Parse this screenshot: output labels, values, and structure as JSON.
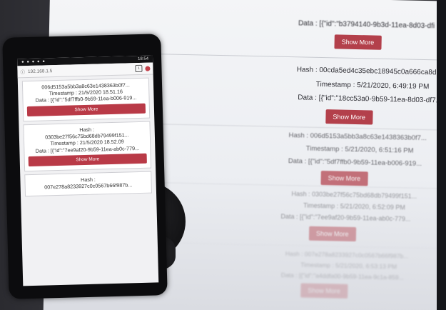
{
  "colors": {
    "button": "#b93a47",
    "monitor_bg": "#eef0f3",
    "phone_body": "#0c0c0e"
  },
  "monitor": {
    "top_data": "Data : [{\"id\":\"b3794140-9b3d-11ea-8d03-dfi",
    "show_more": "Show More",
    "cards": [
      {
        "hash": "Hash : 00cda5ed4c35ebc18945c0a666ca8d...",
        "timestamp": "Timestamp : 5/21/2020, 6:49:19 PM",
        "data": "Data : [{\"id\":\"18cc53a0-9b59-11ea-8d03-df7..."
      },
      {
        "hash": "Hash : 006d5153a5bb3a8c63e1438363b0f7...",
        "timestamp": "Timestamp : 5/21/2020, 6:51:16 PM",
        "data": "Data : [{\"id\":\"5df7ffb0-9b59-11ea-b006-919..."
      },
      {
        "hash": "Hash : 0303be27f56c75bd68db79499f151...",
        "timestamp": "Timestamp : 5/21/2020, 6:52:09 PM",
        "data": "Data : [{\"id\":\"7ee9af20-9b59-11ea-ab0c-779..."
      },
      {
        "hash": "Hash : 007e278a8233927c0c0567b66f987b...",
        "timestamp": "Timestamp : 5/21/2020, 6:53:13 PM",
        "data": "Data : [{\"id\":\"a4ddfa00-9b59-11ea-9c1a-859..."
      }
    ]
  },
  "phone": {
    "status_time": "18:54",
    "url": "192.168.1.5",
    "tab_count": "1",
    "show_more": "Show More",
    "cards": [
      {
        "hash_value": "006d5153a5bb3a8c63e1438363b0f7...",
        "timestamp": "Timestamp : 21/5/2020 18.51.16",
        "data": "Data : [{\"id\":\"5df7ffb0-9b59-11ea-b006-919..."
      },
      {
        "hash_label": "Hash :",
        "hash_value": "0303be27f56c75bd68db79499f151...",
        "timestamp": "Timestamp : 21/5/2020 18.52.09",
        "data": "Data : [{\"id\":\"7ee9af20-9b59-11ea-ab0c-779..."
      },
      {
        "hash_label": "Hash :",
        "hash_value": "007e278a8233927c0c0567b66f987b..."
      }
    ]
  }
}
